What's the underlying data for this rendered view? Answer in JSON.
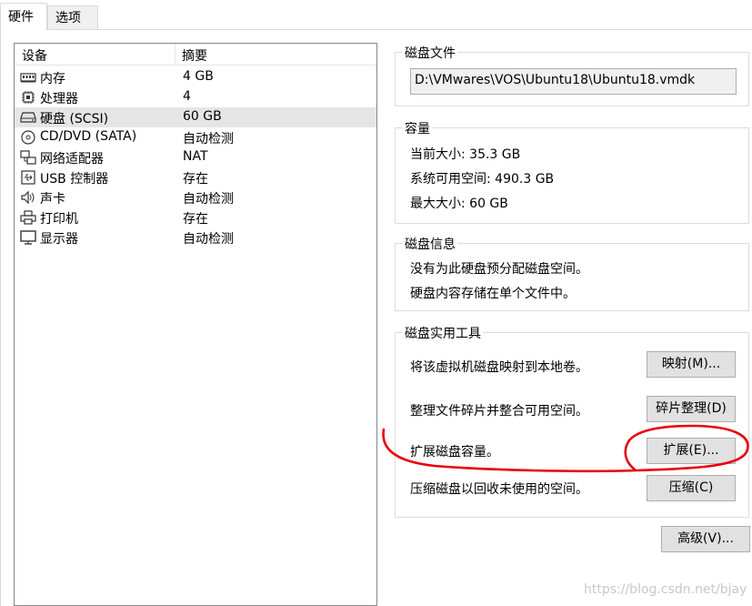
{
  "tabs": {
    "hardware": "硬件",
    "options": "选项"
  },
  "device_list": {
    "col_device": "设备",
    "col_summary": "摘要",
    "items": [
      {
        "name": "内存",
        "summary": "4 GB",
        "icon": "memory-icon"
      },
      {
        "name": "处理器",
        "summary": "4",
        "icon": "cpu-icon"
      },
      {
        "name": "硬盘 (SCSI)",
        "summary": "60 GB",
        "icon": "hard-disk-icon",
        "selected": true
      },
      {
        "name": "CD/DVD (SATA)",
        "summary": "自动检测",
        "icon": "cd-dvd-icon"
      },
      {
        "name": "网络适配器",
        "summary": "NAT",
        "icon": "network-adapter-icon"
      },
      {
        "name": "USB 控制器",
        "summary": "存在",
        "icon": "usb-icon"
      },
      {
        "name": "声卡",
        "summary": "自动检测",
        "icon": "speaker-icon"
      },
      {
        "name": "打印机",
        "summary": "存在",
        "icon": "printer-icon"
      },
      {
        "name": "显示器",
        "summary": "自动检测",
        "icon": "monitor-icon"
      }
    ]
  },
  "disk_file": {
    "title": "磁盘文件",
    "path": "D:\\VMwares\\VOS\\Ubuntu18\\Ubuntu18.vmdk"
  },
  "capacity": {
    "title": "容量",
    "current": "当前大小: 35.3 GB",
    "available": "系统可用空间: 490.3 GB",
    "max": "最大大小: 60 GB"
  },
  "disk_info": {
    "title": "磁盘信息",
    "line1": "没有为此硬盘预分配磁盘空间。",
    "line2": "硬盘内容存储在单个文件中。"
  },
  "utilities": {
    "title": "磁盘实用工具",
    "map_text": "将该虚拟机磁盘映射到本地卷。",
    "map_button": "映射(M)...",
    "defrag_text": "整理文件碎片并整合可用空间。",
    "defrag_button": "碎片整理(D)",
    "expand_text": "扩展磁盘容量。",
    "expand_button": "扩展(E)...",
    "compact_text": "压缩磁盘以回收未使用的空间。",
    "compact_button": "压缩(C)"
  },
  "advanced_button": "高级(V)...",
  "watermark": "https://blog.csdn.net/bjay",
  "colors": {
    "annotation": "#e8000b",
    "selection": "#e5e5e5"
  }
}
